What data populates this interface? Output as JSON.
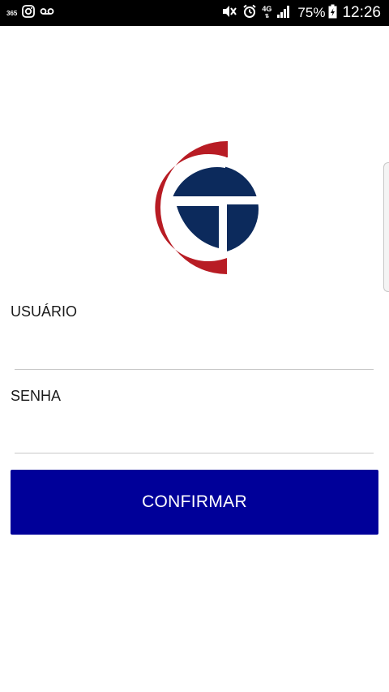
{
  "status_bar": {
    "app_badge": "365",
    "network": "4G",
    "battery": "75%",
    "time": "12:26",
    "icons": [
      "instagram-icon",
      "voicemail-icon",
      "mute-vibrate-icon",
      "alarm-icon",
      "signal-icon",
      "battery-charging-icon"
    ]
  },
  "logo": {
    "colors": {
      "red": "#b81c24",
      "navy": "#0c2a5c"
    }
  },
  "form": {
    "username_label": "USUÁRIO",
    "username_value": "",
    "password_label": "SENHA",
    "password_value": "",
    "confirm_label": "CONFIRMAR"
  },
  "colors": {
    "button": "#000099",
    "status_bar": "#000000",
    "background": "#ffffff"
  }
}
